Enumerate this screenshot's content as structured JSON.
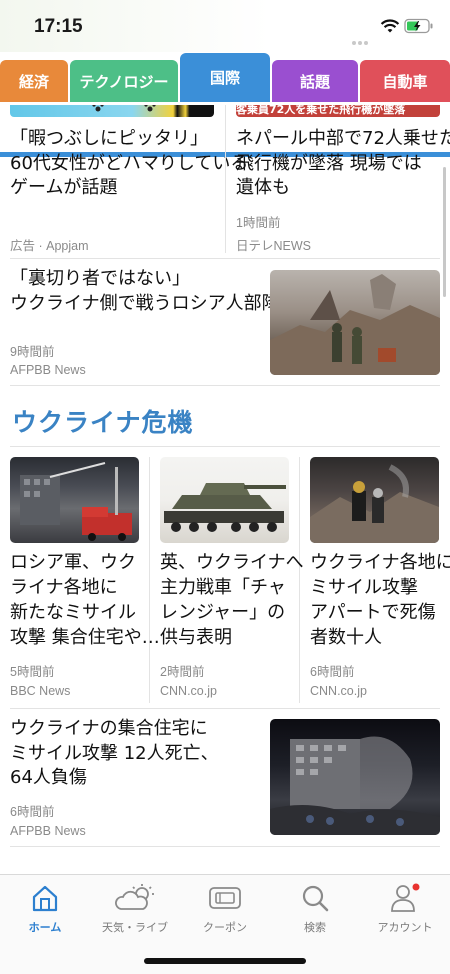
{
  "status": {
    "time": "17:15"
  },
  "tabs": [
    {
      "label": "経済",
      "color": "#e8893a"
    },
    {
      "label": "テクノロジー",
      "color": "#4dbf87"
    },
    {
      "label": "国際",
      "color": "#3b8fd8",
      "active": true
    },
    {
      "label": "話題",
      "color": "#9a4fd0"
    },
    {
      "label": "自動車",
      "color": "#e0505a"
    }
  ],
  "articles": {
    "ad": {
      "headline": "「暇つぶしにピッタリ」60代女性がどハマりしているゲームが話題",
      "line1": "「暇つぶしにピッタリ」",
      "line2": "60代女性がどハマりしている",
      "line3": "ゲームが話題",
      "source": "広告 · Appjam"
    },
    "nepal": {
      "line1": "ネパール中部で72人乗せた",
      "line2": "飛行機が墜落 現場では",
      "line3": "遺体も",
      "time": "1時間前",
      "source": "日テレNEWS",
      "banner_text": "客乗員72人を乗せた飛行機が墜落"
    },
    "traitor": {
      "line1": "「裏切り者ではない」",
      "line2": "ウクライナ側で戦うロシア人部隊",
      "time": "9時間前",
      "source": "AFPBB News"
    }
  },
  "section": {
    "title": "ウクライナ危機",
    "cards": [
      {
        "lines": [
          "ロシア軍、ウク",
          "ライナ各地に",
          "新たなミサイル",
          "攻撃 集合住宅や…"
        ],
        "time": "5時間前",
        "source": "BBC News"
      },
      {
        "lines": [
          "英、ウクライナへ",
          "主力戦車「チャ",
          "レンジャー」の",
          "供与表明"
        ],
        "time": "2時間前",
        "source": "CNN.co.jp"
      },
      {
        "lines": [
          "ウクライナ各地に",
          "ミサイル攻撃",
          "アパートで死傷",
          "者数十人"
        ],
        "time": "6時間前",
        "source": "CNN.co.jp"
      }
    ],
    "wide": {
      "line1": "ウクライナの集合住宅に",
      "line2": "ミサイル攻撃 12人死亡、",
      "line3": "64人負傷",
      "time": "6時間前",
      "source": "AFPBB News"
    }
  },
  "nav": [
    {
      "label": "ホーム",
      "icon": "home-icon",
      "active": true
    },
    {
      "label": "天気・ライブ",
      "icon": "weather-icon"
    },
    {
      "label": "クーポン",
      "icon": "coupon-icon"
    },
    {
      "label": "検索",
      "icon": "search-icon"
    },
    {
      "label": "アカウント",
      "icon": "account-icon",
      "badge": true
    }
  ],
  "colors": {
    "accent": "#3b8fd8",
    "section_title": "#3a83c4",
    "nav_active": "#2c7fcf",
    "badge": "#e8332f"
  }
}
